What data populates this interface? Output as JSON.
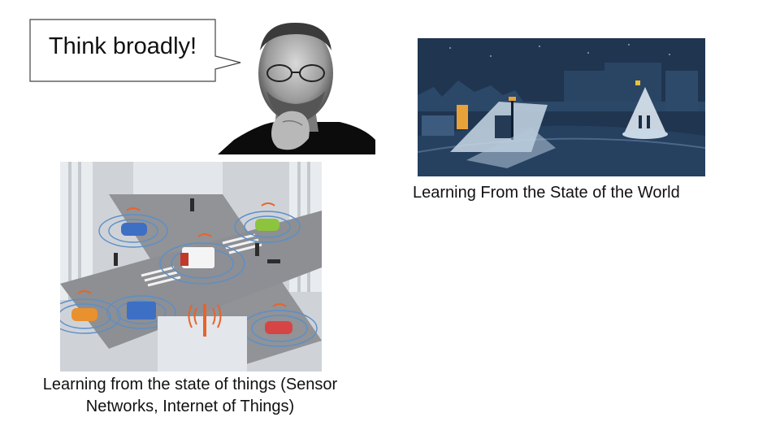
{
  "bubble": {
    "text": "Think broadly!"
  },
  "images": {
    "portrait": {
      "icon": "portrait-photo"
    },
    "night_street": {
      "icon": "night-street-illustration"
    },
    "iot_intersection": {
      "icon": "smart-intersection-illustration"
    }
  },
  "captions": {
    "world": "Learning From the State of the World",
    "things_line1": "Learning from the state of things (Sensor",
    "things_line2": "Networks, Internet of Things)"
  },
  "colors": {
    "night_bg": "#1f3550",
    "night_light": "#c9d8e6",
    "sign_orange": "#e8a23a",
    "road_gray": "#8d8f93",
    "signal_orange": "#e8632a",
    "wave_blue": "#5b8fc9"
  }
}
